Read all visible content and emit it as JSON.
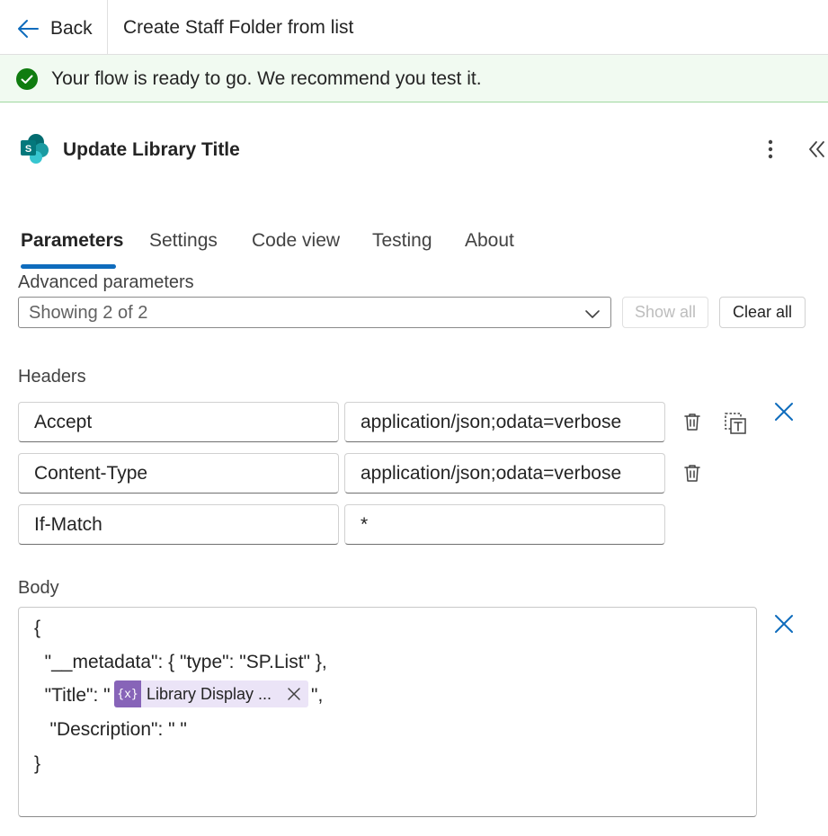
{
  "header": {
    "back_label": "Back",
    "flow_title": "Create Staff Folder from list"
  },
  "banner": {
    "message": "Your flow is ready to go. We recommend you test it.",
    "status_color": "#107c10"
  },
  "action": {
    "title": "Update Library Title",
    "icon": "sharepoint-icon"
  },
  "tabs": [
    {
      "label": "Parameters",
      "active": true
    },
    {
      "label": "Settings",
      "active": false
    },
    {
      "label": "Code view",
      "active": false
    },
    {
      "label": "Testing",
      "active": false
    },
    {
      "label": "About",
      "active": false
    }
  ],
  "advanced": {
    "label": "Advanced parameters",
    "selected": "Showing 2 of 2",
    "show_all": "Show all",
    "clear_all": "Clear all"
  },
  "headers": {
    "label": "Headers",
    "rows": [
      {
        "key": "Accept",
        "value": "application/json;odata=verbose"
      },
      {
        "key": "Content-Type",
        "value": "application/json;odata=verbose"
      },
      {
        "key": "If-Match",
        "value": "*"
      }
    ]
  },
  "body": {
    "label": "Body",
    "lines": [
      "{",
      "  \"__metadata\": { \"type\": \"SP.List\" },",
      "  \"Title\": \"",
      "\",",
      "   \"Description\": \" \"",
      "}"
    ],
    "token": {
      "icon_text": "{x}",
      "label": "Library Display ..."
    }
  },
  "accent_color": "#0f6cbd"
}
